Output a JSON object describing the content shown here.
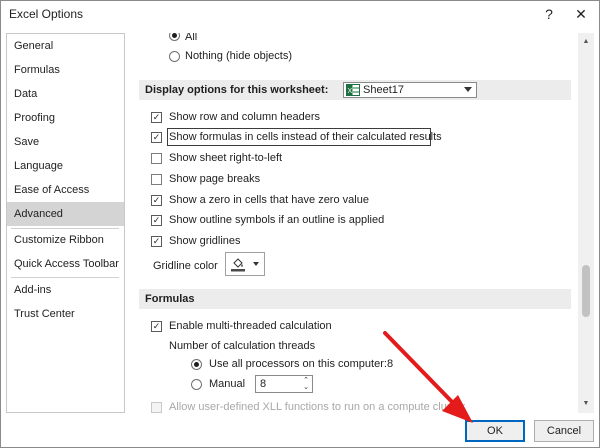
{
  "window": {
    "title": "Excel Options",
    "help_glyph": "?",
    "close_glyph": "✕"
  },
  "sidebar": {
    "items": [
      {
        "label": "General"
      },
      {
        "label": "Formulas"
      },
      {
        "label": "Data"
      },
      {
        "label": "Proofing"
      },
      {
        "label": "Save"
      },
      {
        "label": "Language"
      },
      {
        "label": "Ease of Access"
      },
      {
        "label": "Advanced",
        "selected": true
      },
      {
        "label": "Customize Ribbon"
      },
      {
        "label": "Quick Access Toolbar"
      },
      {
        "label": "Add-ins"
      },
      {
        "label": "Trust Center"
      }
    ]
  },
  "objects": {
    "all_label": "All",
    "nothing_label": "Nothing (hide objects)"
  },
  "worksheet": {
    "section_label": "Display options for this worksheet:",
    "selected_sheet": "Sheet17",
    "options": [
      {
        "label": "Show row and column headers",
        "checked": true
      },
      {
        "label": "Show formulas in cells instead of their calculated results",
        "checked": true
      },
      {
        "label": "Show sheet right-to-left",
        "checked": false
      },
      {
        "label": "Show page breaks",
        "checked": false
      },
      {
        "label": "Show a zero in cells that have zero value",
        "checked": true
      },
      {
        "label": "Show outline symbols if an outline is applied",
        "checked": true
      },
      {
        "label": "Show gridlines",
        "checked": true
      }
    ],
    "gridline_color_label": "Gridline color"
  },
  "formulas": {
    "section_label": "Formulas",
    "multithread_label": "Enable multi-threaded calculation",
    "threads_label": "Number of calculation threads",
    "use_all_label": "Use all processors on this computer:",
    "processor_count": "8",
    "manual_label": "Manual",
    "manual_value": "8",
    "xll_label": "Allow user-defined XLL functions to run on a compute cluster"
  },
  "buttons": {
    "ok": "OK",
    "cancel": "Cancel"
  },
  "colors": {
    "selected_nav": "#d4d4d4",
    "ok_border": "#0067c0",
    "annotation_arrow": "#e31b1b",
    "excel_green": "#1d6f42"
  }
}
